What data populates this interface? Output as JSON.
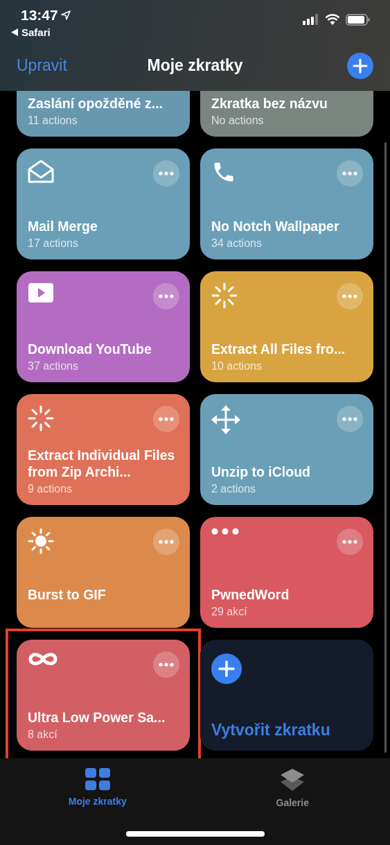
{
  "status_bar": {
    "time": "13:47",
    "back_app": "Safari"
  },
  "nav": {
    "edit": "Upravit",
    "title": "Moje zkratky"
  },
  "cards": [
    {
      "title": "Zaslání opožděné z...",
      "subtitle": "11 actions",
      "color": "#6898b0",
      "highlighted": false
    },
    {
      "title": "Zkratka bez názvu",
      "subtitle": "No actions",
      "color": "#7b8580",
      "highlighted": false
    },
    {
      "title": "Mail Merge",
      "subtitle": "17 actions",
      "color": "#6a9fb7",
      "highlighted": false
    },
    {
      "title": "No Notch Wallpaper",
      "subtitle": "34 actions",
      "color": "#6a9fb7",
      "highlighted": false
    },
    {
      "title": "Download YouTube",
      "subtitle": "37 actions",
      "color": "#b46cc2",
      "highlighted": false
    },
    {
      "title": "Extract All Files fro...",
      "subtitle": "10 actions",
      "color": "#d8a441",
      "highlighted": false
    },
    {
      "title": "Extract Individual Files from Zip Archi...",
      "subtitle": "9 actions",
      "color": "#df7158",
      "highlighted": false
    },
    {
      "title": "Unzip to iCloud",
      "subtitle": "2 actions",
      "color": "#6a9fb7",
      "highlighted": false
    },
    {
      "title": "Burst to GIF",
      "color": "#dc8a4c",
      "highlighted": false
    },
    {
      "title": "PwnedWord",
      "subtitle": "29 akcí",
      "color": "#d8595f",
      "highlighted": false
    },
    {
      "title": "Ultra Low Power Sa...",
      "subtitle": "8 akcí",
      "color": "#d25f63",
      "highlighted": true
    }
  ],
  "create_card": {
    "label": "Vytvořit zkratku"
  },
  "tabs": [
    {
      "label": "Moje zkratky",
      "selected": true
    },
    {
      "label": "Galerie",
      "selected": false
    }
  ]
}
